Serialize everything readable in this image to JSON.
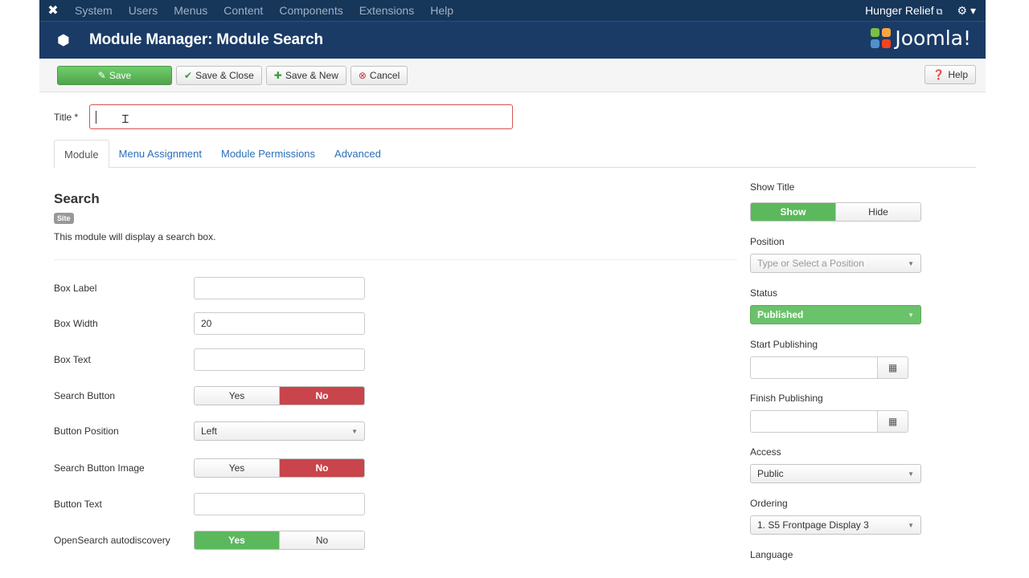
{
  "topnav": {
    "menu": [
      "System",
      "Users",
      "Menus",
      "Content",
      "Components",
      "Extensions",
      "Help"
    ],
    "site_name": "Hunger Relief"
  },
  "header": {
    "title": "Module Manager: Module Search",
    "brand": "Joomla!"
  },
  "toolbar": {
    "save": "Save",
    "save_close": "Save & Close",
    "save_new": "Save & New",
    "cancel": "Cancel",
    "help": "Help"
  },
  "title_field": {
    "label": "Title *",
    "value": ""
  },
  "tabs": [
    "Module",
    "Menu Assignment",
    "Module Permissions",
    "Advanced"
  ],
  "module": {
    "name": "Search",
    "badge": "Site",
    "description": "This module will display a search box."
  },
  "fields": {
    "box_label": {
      "label": "Box Label",
      "value": ""
    },
    "box_width": {
      "label": "Box Width",
      "value": "20"
    },
    "box_text": {
      "label": "Box Text",
      "value": ""
    },
    "search_button": {
      "label": "Search Button",
      "yes": "Yes",
      "no": "No",
      "selected": "No"
    },
    "button_position": {
      "label": "Button Position",
      "value": "Left"
    },
    "search_button_image": {
      "label": "Search Button Image",
      "yes": "Yes",
      "no": "No",
      "selected": "No"
    },
    "button_text": {
      "label": "Button Text",
      "value": ""
    },
    "opensearch_autodiscovery": {
      "label": "OpenSearch autodiscovery",
      "yes": "Yes",
      "no": "No",
      "selected": "Yes"
    }
  },
  "sidebar": {
    "show_title": {
      "label": "Show Title",
      "show": "Show",
      "hide": "Hide",
      "selected": "Show"
    },
    "position": {
      "label": "Position",
      "placeholder": "Type or Select a Position"
    },
    "status": {
      "label": "Status",
      "value": "Published"
    },
    "start_publishing": {
      "label": "Start Publishing",
      "value": ""
    },
    "finish_publishing": {
      "label": "Finish Publishing",
      "value": ""
    },
    "access": {
      "label": "Access",
      "value": "Public"
    },
    "ordering": {
      "label": "Ordering",
      "value": "1. S5 Frontpage Display 3"
    },
    "language": {
      "label": "Language"
    }
  },
  "colors": {
    "nav_bg": "#16365a",
    "header_bg": "#1a3b66",
    "save_green": "#5cb85c",
    "toggle_red": "#c9454b",
    "link_blue": "#2a6ebb"
  }
}
